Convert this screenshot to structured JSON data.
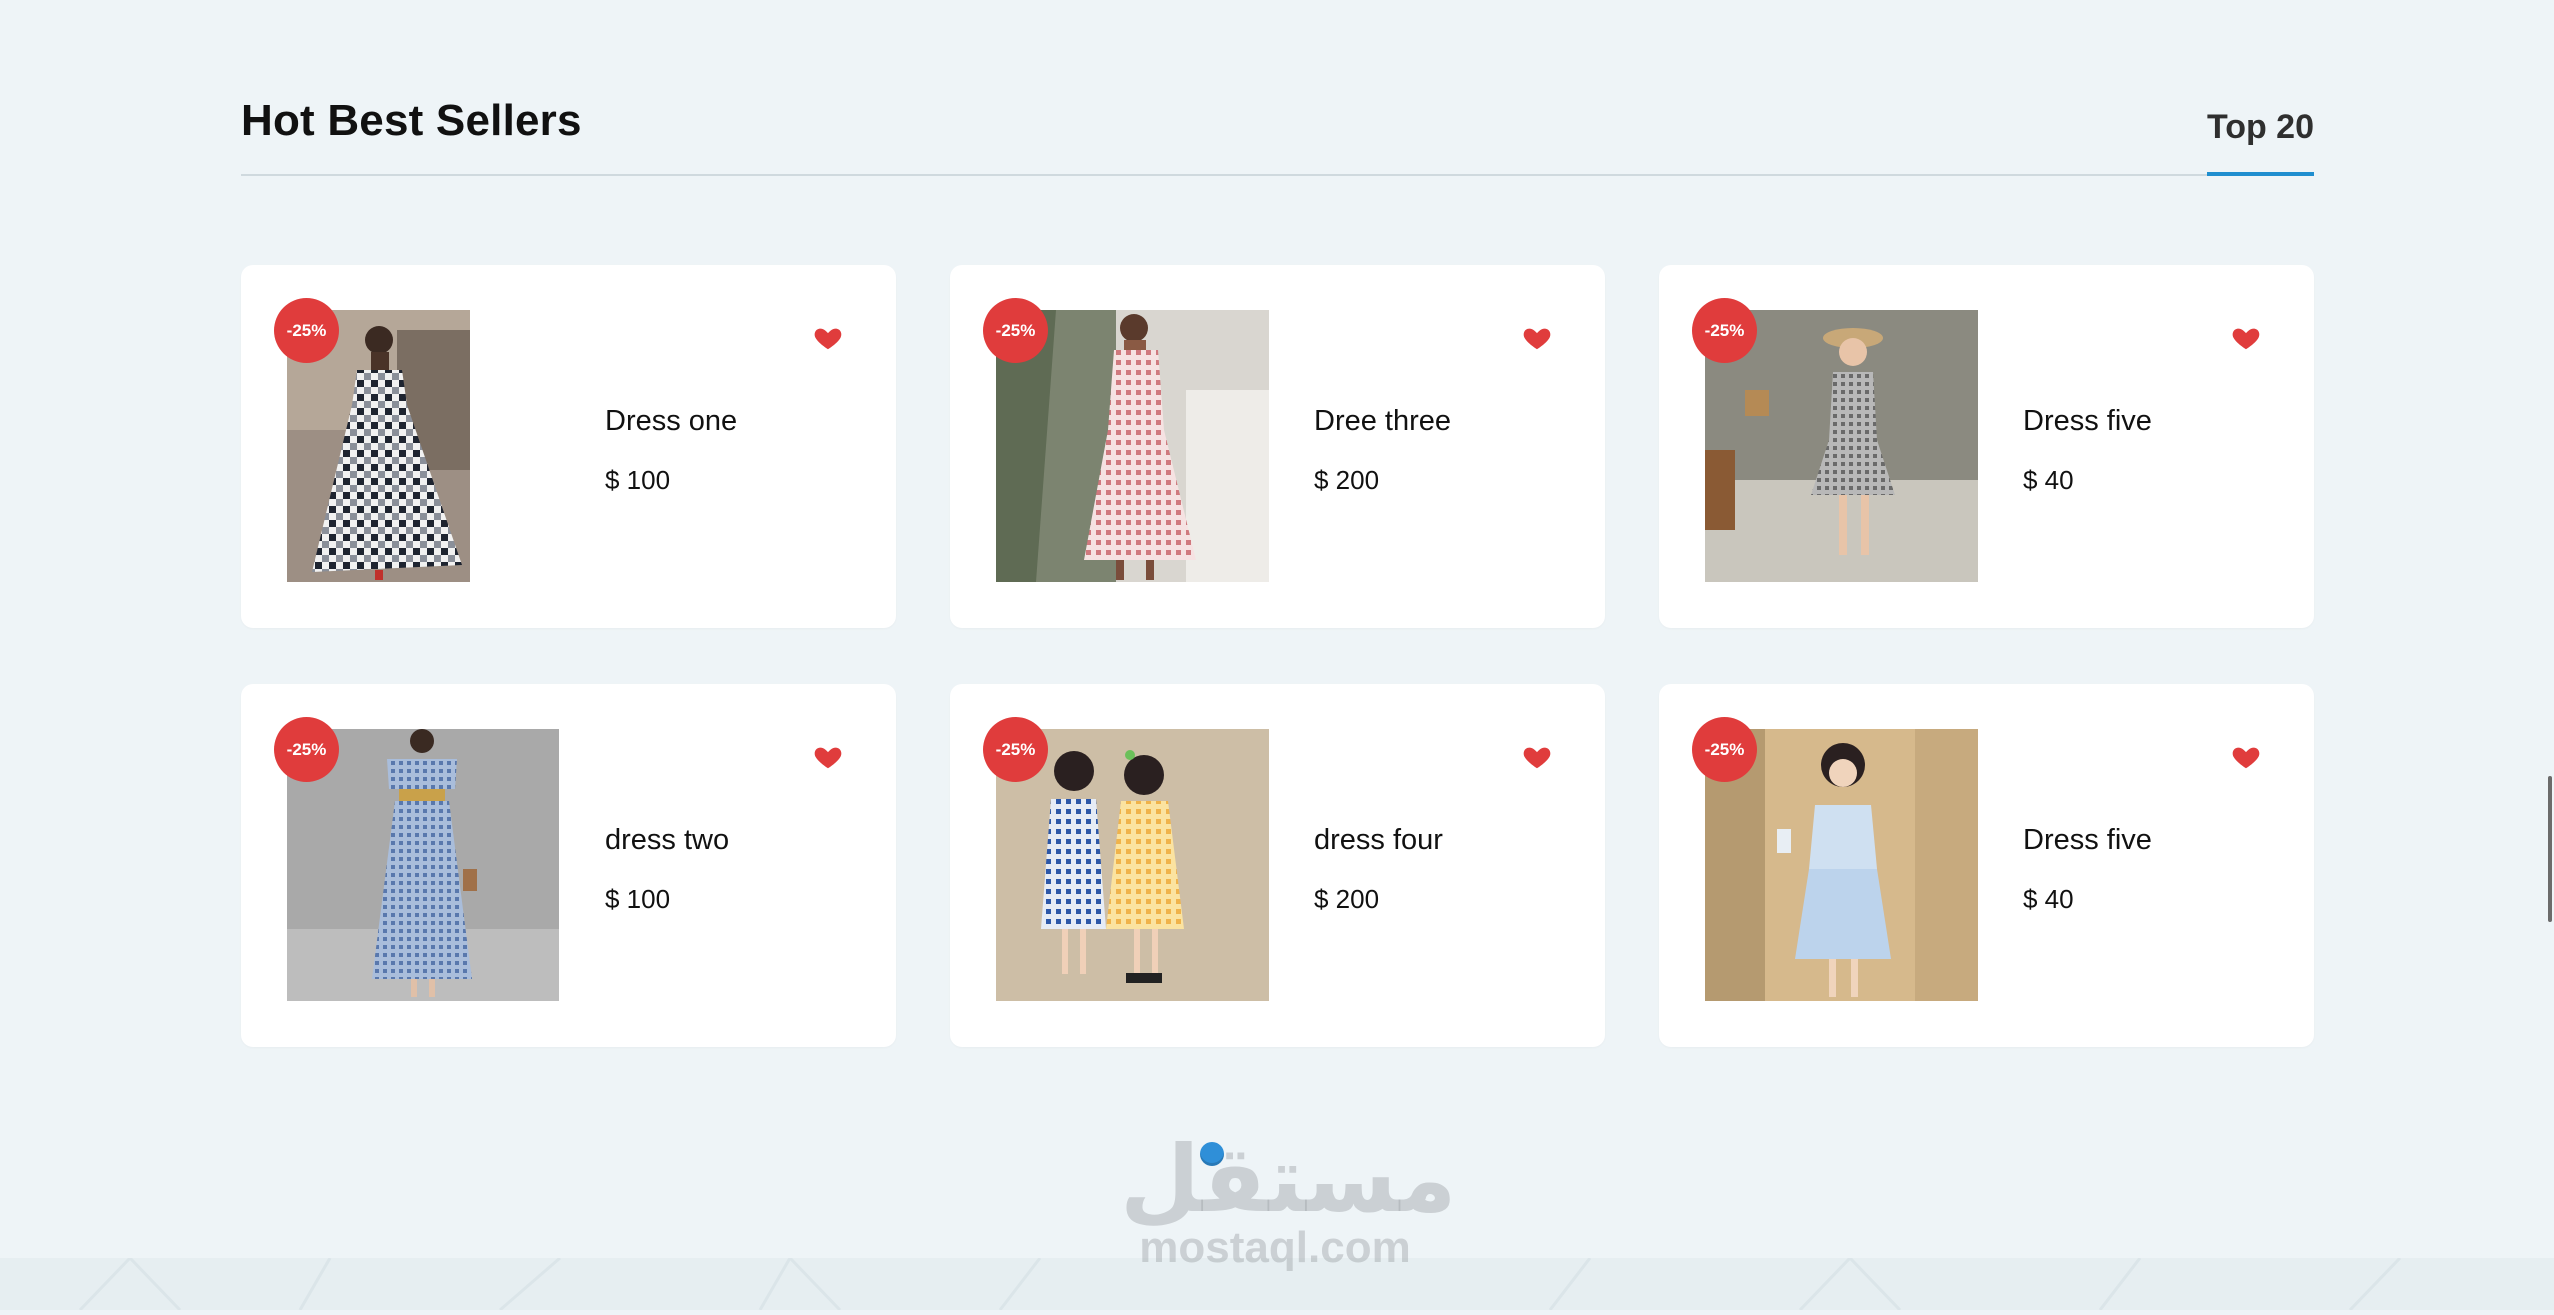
{
  "section": {
    "title": "Hot Best Sellers",
    "tab_label": "Top 20",
    "accent_color": "#1f8ecf"
  },
  "products": [
    {
      "name": "Dress one",
      "price": "$ 100",
      "discount": "-25%",
      "image": "checkered-maxi-dress-photo"
    },
    {
      "name": "Dree three",
      "price": "$ 200",
      "discount": "-25%",
      "image": "pink-gingham-dress-photo"
    },
    {
      "name": "Dress five",
      "price": "$ 40",
      "discount": "-25%",
      "image": "girl-grey-dress-photo"
    },
    {
      "name": "dress two",
      "price": "$ 100",
      "discount": "-25%",
      "image": "blue-gingham-offshoulder-dress-photo"
    },
    {
      "name": "dress four",
      "price": "$ 200",
      "discount": "-25%",
      "image": "two-girls-gingham-dresses-photo"
    },
    {
      "name": "Dress five",
      "price": "$ 40",
      "discount": "-25%",
      "image": "girl-lightblue-dress-photo"
    }
  ],
  "badge_color": "#e03c3c",
  "heart_color": "#e03c3c",
  "watermark": {
    "mark": "مستقل",
    "domain": "mostaql.com"
  }
}
